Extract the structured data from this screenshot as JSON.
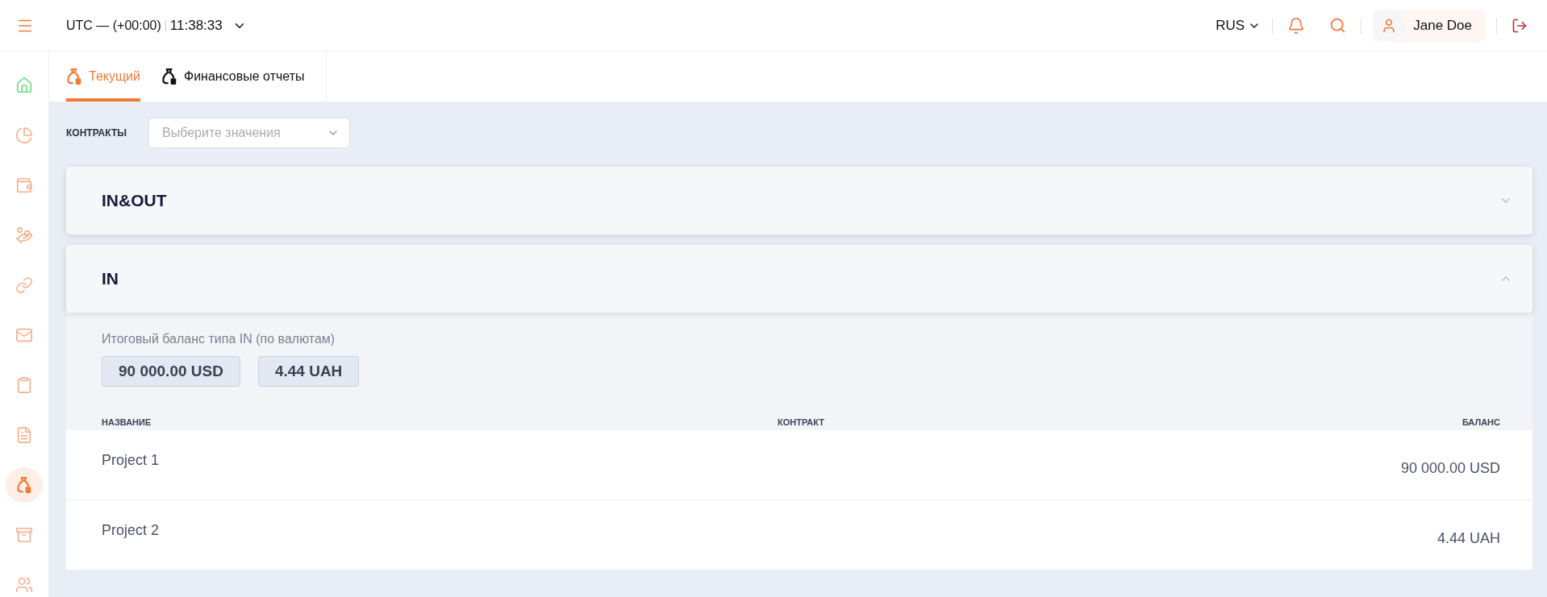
{
  "header": {
    "timezone": "UTC — (+00:00)",
    "time": "11:38:33",
    "language": "RUS",
    "user": "Jane Doe"
  },
  "sidebar": {
    "items": [
      {
        "kind": "home",
        "color": "#6fdc80",
        "selected": false
      },
      {
        "kind": "pie",
        "color": "#f6b08c",
        "selected": false
      },
      {
        "kind": "wallet",
        "color": "#f6b08c",
        "selected": false
      },
      {
        "kind": "hand",
        "color": "#f6b08c",
        "selected": false
      },
      {
        "kind": "link",
        "color": "#f6b08c",
        "selected": false
      },
      {
        "kind": "mail",
        "color": "#f6b08c",
        "selected": false
      },
      {
        "kind": "clipboard",
        "color": "#f6b08c",
        "selected": false
      },
      {
        "kind": "document",
        "color": "#f6b08c",
        "selected": false
      },
      {
        "kind": "bag",
        "color": "#f07a3a",
        "selected": true
      },
      {
        "kind": "archive",
        "color": "#f6b08c",
        "selected": false
      },
      {
        "kind": "users",
        "color": "#f6b08c",
        "selected": false
      }
    ]
  },
  "tabs": [
    {
      "label": "Текущий",
      "selected": true
    },
    {
      "label": "Финансовые отчеты",
      "selected": false
    }
  ],
  "filter": {
    "label": "КОНТРАКТЫ",
    "placeholder": "Выберите значения"
  },
  "sections": [
    {
      "title": "IN&OUT",
      "expanded": false
    },
    {
      "title": "IN",
      "expanded": true,
      "summary_label": "Итоговый баланс типа IN (по валютам)",
      "totals": [
        "90 000.00 USD",
        "4.44 UAH"
      ],
      "table": {
        "columns": [
          "НАЗВАНИЕ",
          "КОНТРАКТ",
          "БАЛАНС"
        ],
        "rows": [
          [
            "Project 1",
            "",
            "90 000.00 USD"
          ],
          [
            "Project 2",
            "",
            "4.44 UAH"
          ]
        ]
      }
    }
  ]
}
